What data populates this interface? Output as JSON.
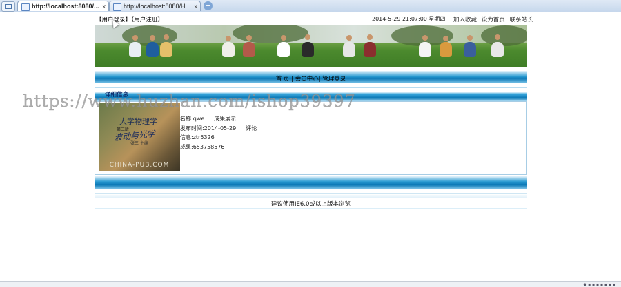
{
  "browser": {
    "tabs": [
      {
        "label": "http://localhost:8080/...",
        "active": true
      },
      {
        "label": "http://localhost:8080/H...",
        "active": false
      }
    ],
    "new_tab_icon": "+",
    "close_icon": "x"
  },
  "header": {
    "login_links": [
      "【用户登录】",
      "【用户注册】"
    ],
    "datetime": "2014-5-29 21:07:00 星期四",
    "top_links": [
      "加入收藏",
      "设为首页",
      "联系站长"
    ]
  },
  "nav": {
    "items": [
      "首 页",
      "|",
      "会员中心",
      "|",
      "管理登录"
    ]
  },
  "detail": {
    "title": "详细信息",
    "book_cover": {
      "title": "大学物理学",
      "subtitle": "第三版",
      "main": "波动与光学",
      "author": "张三 主编",
      "brand": "CHINA-PUB.COM"
    },
    "rows": [
      {
        "label": "名称:",
        "value": "qwe",
        "link": "成果展示"
      },
      {
        "label": "发布时间:",
        "value": "2014-05-29",
        "link": "评论"
      },
      {
        "label": "信息:",
        "value": "ztr5326",
        "link": ""
      },
      {
        "label": "成果:",
        "value": "653758576",
        "link": ""
      }
    ]
  },
  "footer": {
    "text": "建议使用IE6.0或以上版本浏览"
  },
  "watermark": "https://www.huzhan.com/ishop39397",
  "colors": {
    "nav_blue": "#0a78b6",
    "title_blue": "#0b2a6b"
  }
}
